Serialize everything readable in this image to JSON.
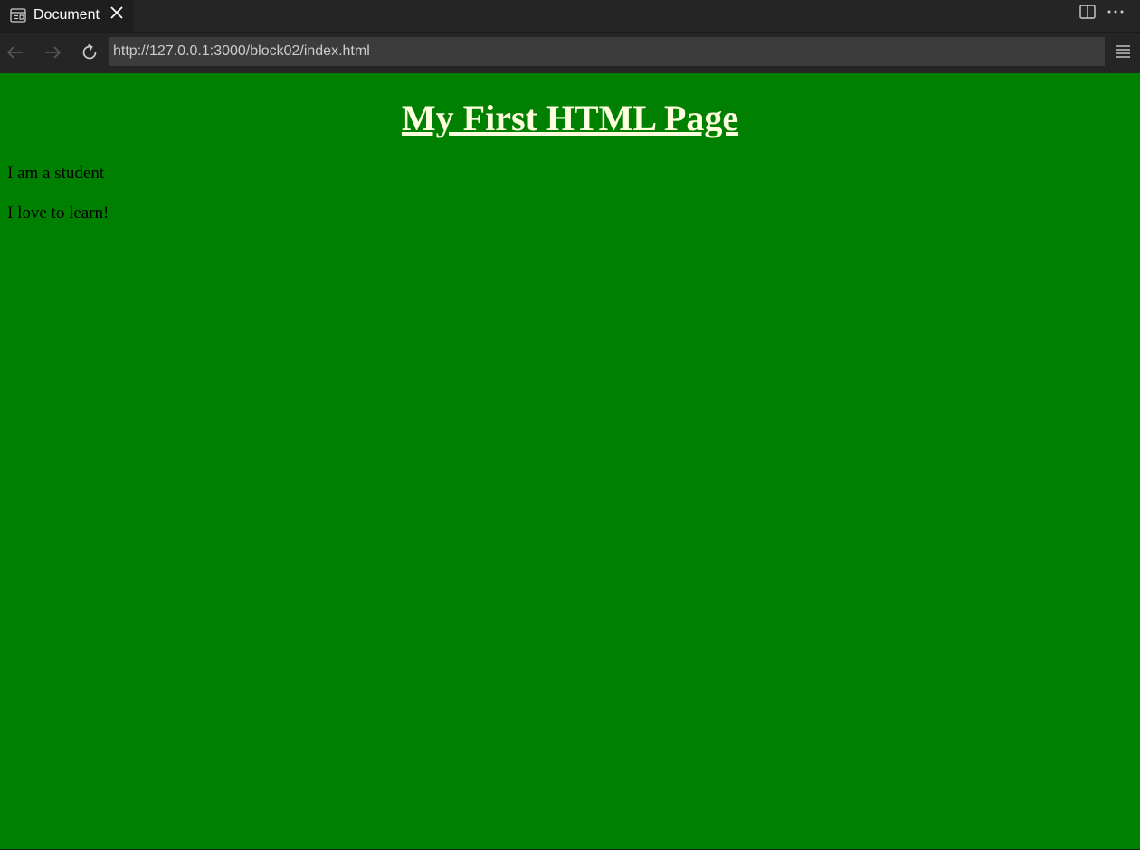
{
  "browser": {
    "tab": {
      "icon": "preview-icon",
      "title": "Document",
      "close_icon": "close-icon"
    },
    "toolbar_icons": [
      "split-editor-icon",
      "more-actions-icon"
    ],
    "nav": {
      "back_icon": "arrow-left-icon",
      "forward_icon": "arrow-right-icon",
      "reload_icon": "refresh-icon",
      "url": "http://127.0.0.1:3000/block02/index.html",
      "menu_icon": "hamburger-menu-icon"
    }
  },
  "page": {
    "background_color": "#008000",
    "heading": "My First HTML Page",
    "heading_color": "#ffffe0",
    "paragraphs": [
      "I am a student",
      "I love to learn!"
    ]
  }
}
